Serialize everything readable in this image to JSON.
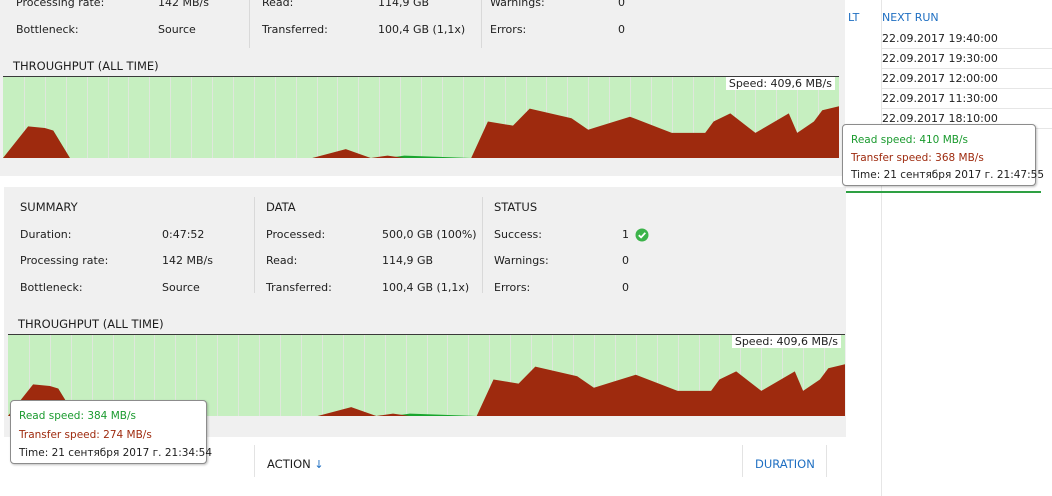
{
  "top": {
    "summary": {
      "processing_rate_label": "Processing rate:",
      "processing_rate": "142 MB/s",
      "bottleneck_label": "Bottleneck:",
      "bottleneck": "Source"
    },
    "data": {
      "read_label": "Read:",
      "read": "114,9 GB",
      "transferred_label": "Transferred:",
      "transferred": "100,4 GB (1,1x)"
    },
    "status": {
      "warnings_label": "Warnings:",
      "warnings": "0",
      "errors_label": "Errors:",
      "errors": "0"
    },
    "throughput_title": "THROUGHPUT (ALL TIME)",
    "speed": "Speed: 409,6 MB/s"
  },
  "top_tooltip": {
    "read": "Read speed: 410 MB/s",
    "transfer": "Transfer speed: 368 MB/s",
    "time": "Time: 21 сентября 2017 г. 21:47:55"
  },
  "bottom": {
    "summary": {
      "title": "SUMMARY",
      "duration_label": "Duration:",
      "duration": "0:47:52",
      "processing_rate_label": "Processing rate:",
      "processing_rate": "142 MB/s",
      "bottleneck_label": "Bottleneck:",
      "bottleneck": "Source"
    },
    "data": {
      "title": "DATA",
      "processed_label": "Processed:",
      "processed": "500,0 GB (100%)",
      "read_label": "Read:",
      "read": "114,9 GB",
      "transferred_label": "Transferred:",
      "transferred": "100,4 GB (1,1x)"
    },
    "status": {
      "title": "STATUS",
      "success_label": "Success:",
      "success": "1",
      "warnings_label": "Warnings:",
      "warnings": "0",
      "errors_label": "Errors:",
      "errors": "0"
    },
    "throughput_title": "THROUGHPUT (ALL TIME)",
    "speed": "Speed: 409,6 MB/s"
  },
  "bottom_tooltip": {
    "read": "Read speed: 384 MB/s",
    "transfer": "Transfer speed: 274 MB/s",
    "time": "Time: 21 сентября 2017 г. 21:34:54"
  },
  "right_panel": {
    "partial_header": "LT",
    "next_run_header": "NEXT RUN",
    "rows": [
      "22.09.2017 19:40:00",
      "22.09.2017 19:30:00",
      "22.09.2017 12:00:00",
      "22.09.2017 11:30:00",
      "22.09.2017 18:10:00"
    ]
  },
  "table_header": {
    "action": "ACTION",
    "action_arrow": "↓",
    "duration": "DURATION"
  },
  "colors": {
    "read_series": "#19a52e",
    "transfer_series": "#9e2a0e",
    "background_fill": "#c6efc0",
    "link_blue": "#1f6fc2"
  },
  "chart_data": [
    {
      "type": "area",
      "title": "THROUGHPUT (ALL TIME)",
      "annotation": "Speed: 409,6 MB/s",
      "grid": true,
      "x": [
        0,
        3,
        5,
        6,
        8,
        11,
        12,
        16,
        37,
        41,
        44,
        46,
        48,
        56,
        58,
        61,
        63,
        68,
        70,
        75,
        80,
        84,
        85,
        87,
        90,
        94,
        95,
        97,
        98,
        100
      ],
      "series": [
        {
          "values": [
            0,
            25,
            15,
            34,
            0,
            0,
            0,
            0,
            0,
            4,
            0,
            0,
            3,
            0,
            6,
            0,
            0,
            10,
            5,
            0,
            0,
            0,
            0,
            0,
            0,
            0,
            0,
            0,
            0,
            0
          ]
        },
        {
          "values": [
            0,
            39,
            37,
            34,
            0,
            0,
            0,
            0,
            0,
            11,
            0,
            3,
            0,
            0,
            45,
            40,
            61,
            49,
            35,
            51,
            31,
            31,
            45,
            55,
            31,
            55,
            31,
            45,
            59,
            64
          ]
        }
      ],
      "ylim": [
        0,
        100
      ]
    }
  ]
}
